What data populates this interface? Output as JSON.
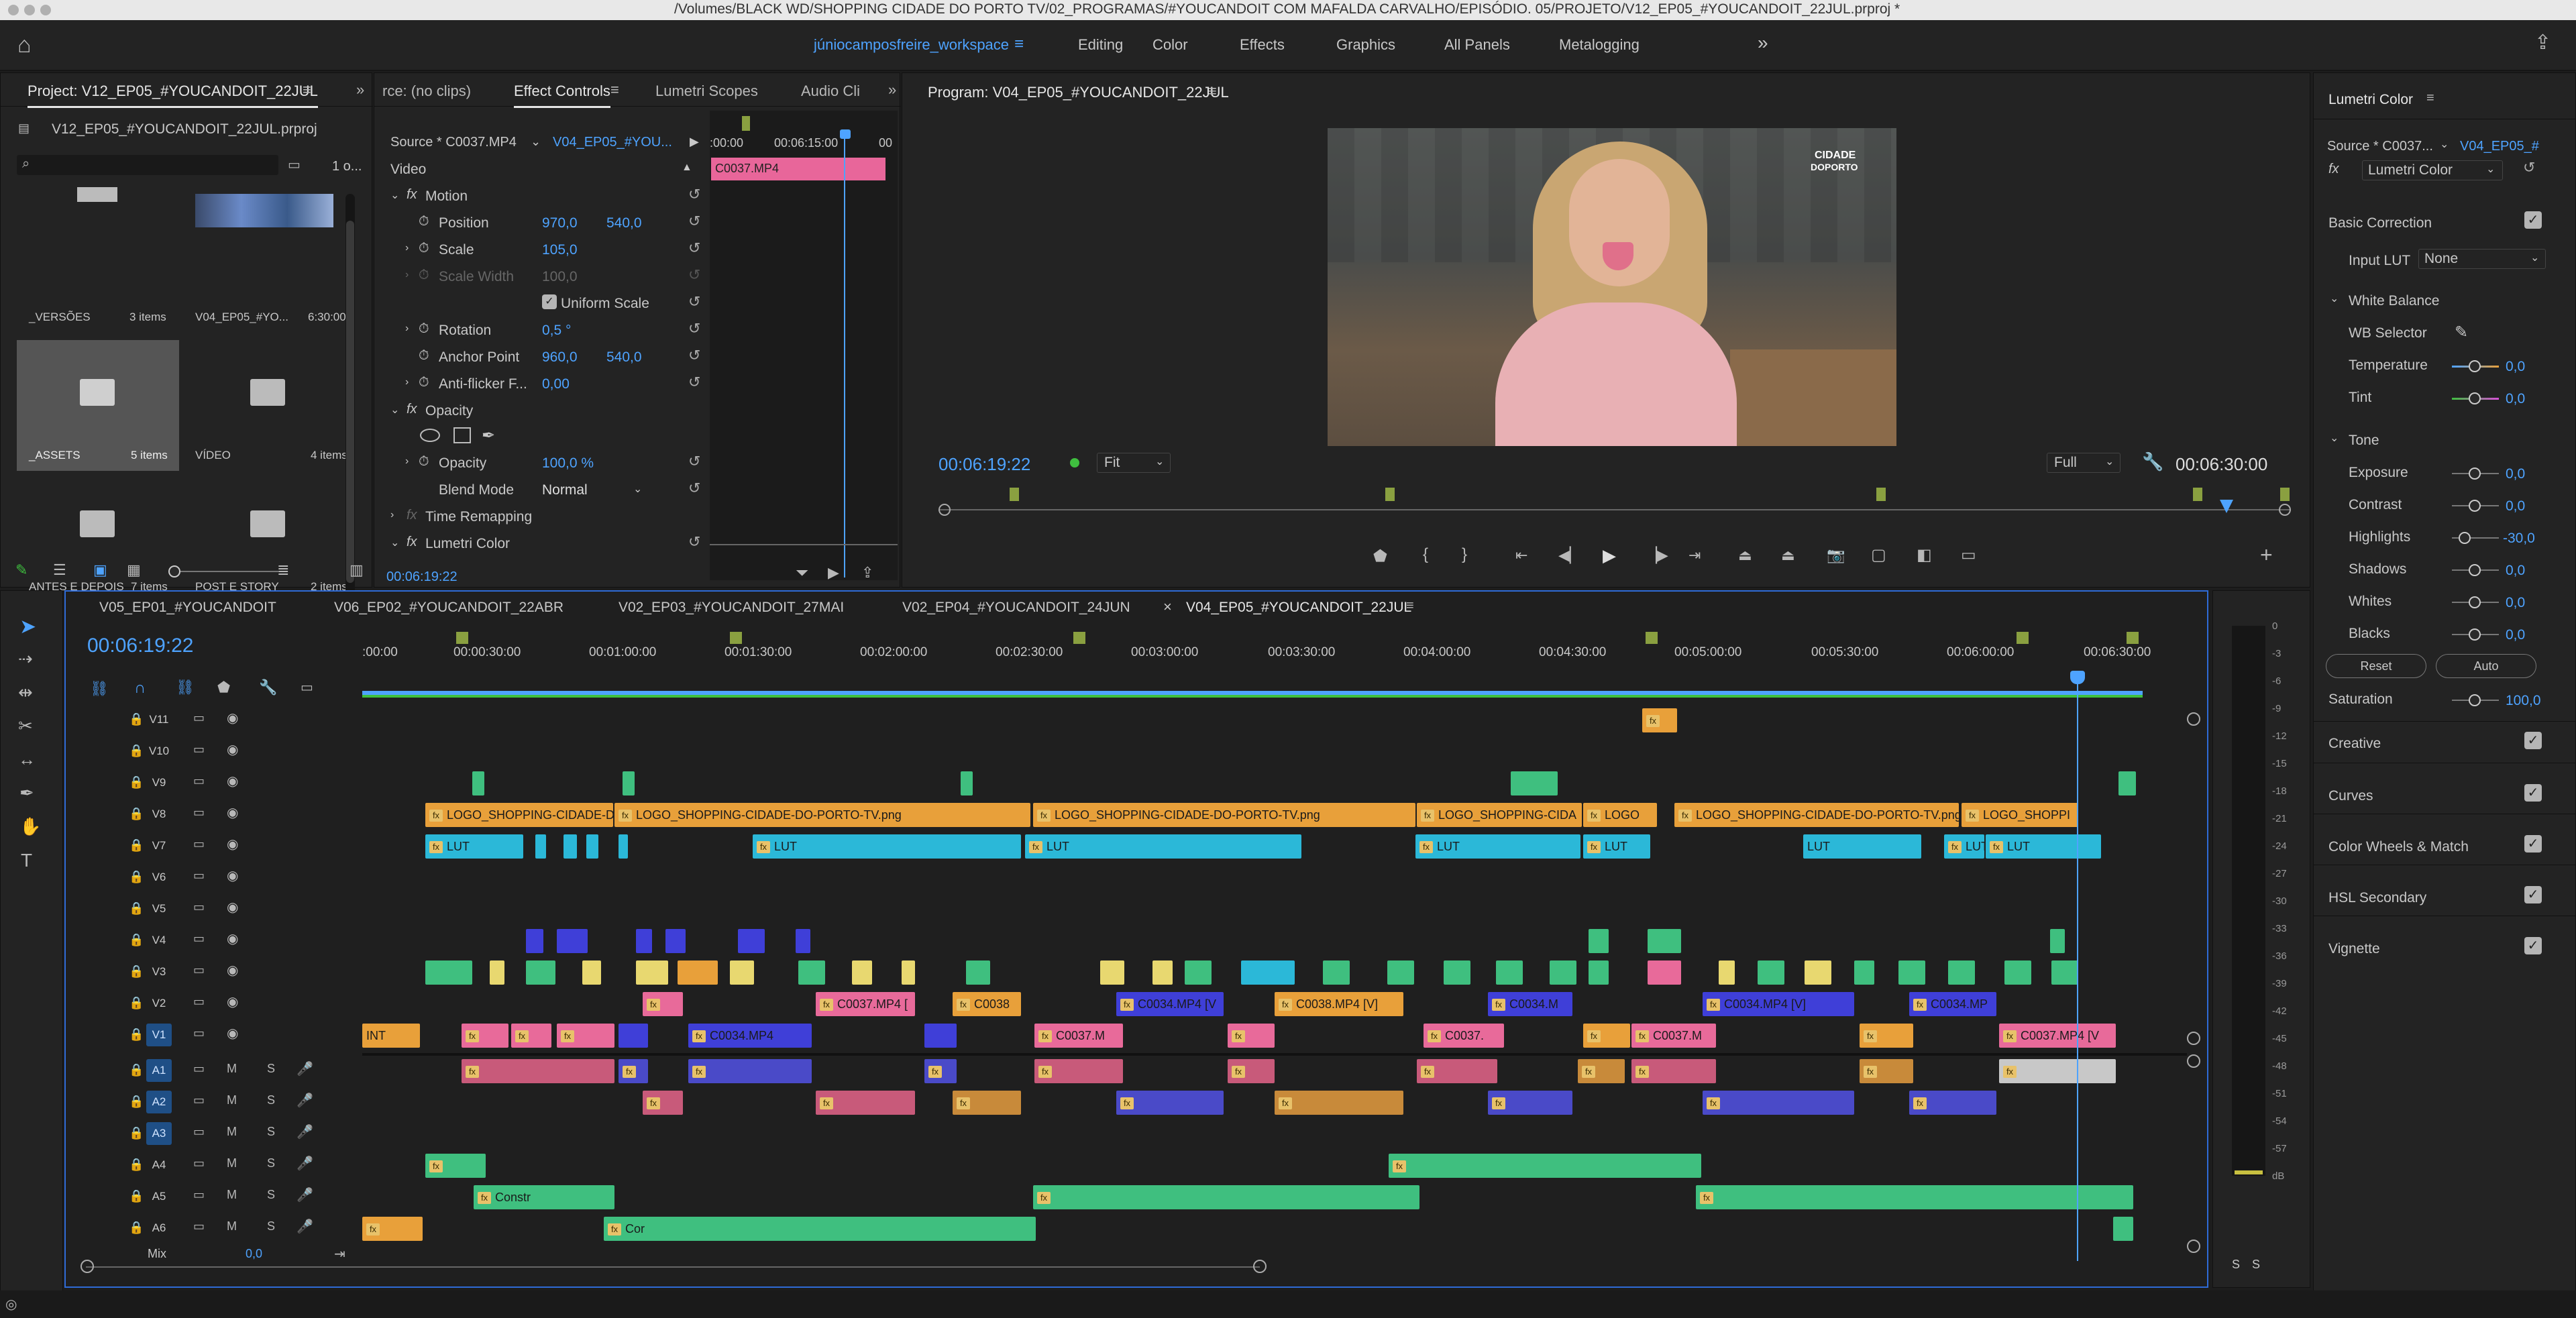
{
  "window": {
    "title": "/Volumes/BLACK WD/SHOPPING CIDADE DO PORTO TV/02_PROGRAMAS/#YOUCANDOIT COM MAFALDA CARVALHO/EPISÓDIO. 05/PROJETO/V12_EP05_#YOUCANDOIT_22JUL.prproj *"
  },
  "workspaces": {
    "items": [
      "júniocamposfreire_workspace",
      "Editing",
      "Color",
      "Effects",
      "Graphics",
      "All Panels",
      "Metalogging"
    ],
    "more": "»"
  },
  "project": {
    "tab": "Project: V12_EP05_#YOUCANDOIT_22JUL",
    "file": "V12_EP05_#YOUCANDOIT_22JUL.prproj",
    "count": "1 o...",
    "bins": [
      {
        "name": "_VERSÕES",
        "count": "3 items"
      },
      {
        "name": "V04_EP05_#YO...",
        "count": "6:30:00"
      },
      {
        "name": "_ASSETS",
        "count": "5 items"
      },
      {
        "name": "VÍDEO",
        "count": "4 items"
      },
      {
        "name": "ANTES E DEPOIS",
        "count": "7 items"
      },
      {
        "name": "POST E STORY",
        "count": "2 items"
      }
    ]
  },
  "effect_controls": {
    "tabs": [
      "rce: (no clips)",
      "Effect Controls",
      "Lumetri Scopes",
      "Audio Cli"
    ],
    "source": "Source * C0037.MP4",
    "sequence": "V04_EP05_#YOU...",
    "mini_times": [
      ":00:00",
      "00:06:15:00",
      "00"
    ],
    "clip_label": "C0037.MP4",
    "section_video": "Video",
    "motion": "Motion",
    "position_label": "Position",
    "position_x": "970,0",
    "position_y": "540,0",
    "scale_label": "Scale",
    "scale_value": "105,0",
    "scale_width_label": "Scale Width",
    "scale_width_value": "100,0",
    "uniform_scale": "Uniform Scale",
    "rotation_label": "Rotation",
    "rotation_value": "0,5 °",
    "anchor_label": "Anchor Point",
    "anchor_x": "960,0",
    "anchor_y": "540,0",
    "antiflicker_label": "Anti-flicker F...",
    "antiflicker_value": "0,00",
    "opacity": "Opacity",
    "opacity_label": "Opacity",
    "opacity_value": "100,0 %",
    "blend_label": "Blend Mode",
    "blend_value": "Normal",
    "time_remap": "Time Remapping",
    "lumetri": "Lumetri Color",
    "timecode": "00:06:19:22"
  },
  "program": {
    "title": "Program: V04_EP05_#YOUCANDOIT_22JUL",
    "timecode": "00:06:19:22",
    "fit": "Fit",
    "full": "Full",
    "duration": "00:06:30:00",
    "logo_line1": "CIDADE",
    "logo_line2": "DOPORTO"
  },
  "lumetri": {
    "title": "Lumetri Color",
    "source": "Source * C0037...",
    "seq": "V04_EP05_#",
    "fx": "Lumetri Color",
    "basic": "Basic Correction",
    "input_lut_label": "Input LUT",
    "input_lut_value": "None",
    "wb": "White Balance",
    "wb_selector": "WB Selector",
    "temperature": "Temperature",
    "temperature_val": "0,0",
    "tint": "Tint",
    "tint_val": "0,0",
    "tone": "Tone",
    "exposure": "Exposure",
    "exposure_val": "0,0",
    "contrast": "Contrast",
    "contrast_val": "0,0",
    "highlights": "Highlights",
    "highlights_val": "-30,0",
    "shadows": "Shadows",
    "shadows_val": "0,0",
    "whites": "Whites",
    "whites_val": "0,0",
    "blacks": "Blacks",
    "blacks_val": "0,0",
    "reset": "Reset",
    "auto": "Auto",
    "saturation": "Saturation",
    "saturation_val": "100,0",
    "sections": [
      "Creative",
      "Curves",
      "Color Wheels & Match",
      "HSL Secondary",
      "Vignette"
    ]
  },
  "timeline": {
    "tabs": [
      "V05_EP01_#YOUCANDOIT",
      "V06_EP02_#YOUCANDOIT_22ABR",
      "V02_EP03_#YOUCANDOIT_27MAI",
      "V02_EP04_#YOUCANDOIT_24JUN",
      "V04_EP05_#YOUCANDOIT_22JUL"
    ],
    "timecode": "00:06:19:22",
    "ruler": [
      ":00:00",
      "00:00:30:00",
      "00:01:00:00",
      "00:01:30:00",
      "00:02:00:00",
      "00:02:30:00",
      "00:03:00:00",
      "00:03:30:00",
      "00:04:00:00",
      "00:04:30:00",
      "00:05:00:00",
      "00:05:30:00",
      "00:06:00:00",
      "00:06:30:00"
    ],
    "video_tracks": [
      "V11",
      "V10",
      "V9",
      "V8",
      "V7",
      "V6",
      "V5",
      "V4",
      "V3",
      "V2",
      "V1"
    ],
    "audio_tracks": [
      "A1",
      "A2",
      "A3",
      "A4",
      "A5",
      "A6"
    ],
    "mix": "Mix",
    "mix_val": "0,0",
    "clip_labels": {
      "logo": "LOGO_SHOPPING-CIDADE-D",
      "logo_full": "LOGO_SHOPPING-CIDADE-DO-PORTO-TV.png",
      "logo_short": "LOGO_SHOPPING-CIDA",
      "logo_tiny": "LOGO",
      "logo_end": "LOGO_SHOPPI",
      "lut": "LUT",
      "int": "INT",
      "c0034": "C0034.MP4",
      "c0034v": "C0034.MP4 [V",
      "c0034vb": "C0034.MP4 [V]",
      "c0034m": "C0034.M",
      "c0034mp": "C0034.MP",
      "c0037": "C0037.MP4 [",
      "c0037m": "C0037.M",
      "c0037b": "C0037.",
      "c0037v": "C0037.MP4 [V",
      "c0038": "C0038",
      "c0038v": "C0038.MP4 [V]",
      "const": "Constr",
      "cor": "Cor"
    }
  },
  "meter": {
    "ticks": [
      "0",
      "-3",
      "-6",
      "-9",
      "-12",
      "-15",
      "-18",
      "-21",
      "-24",
      "-27",
      "-30",
      "-33",
      "-36",
      "-39",
      "-42",
      "-45",
      "-48",
      "-51",
      "-54",
      "-57",
      "dB"
    ],
    "solo": "S"
  },
  "colors": {
    "accent": "#4ea3ff",
    "orange": "#e8a03a",
    "cyan": "#2bb8d8",
    "pink": "#e86a9a",
    "blue": "#3f3fd8",
    "green": "#3fbf7f",
    "yellow": "#e8d870",
    "purple": "#b84fd8"
  }
}
